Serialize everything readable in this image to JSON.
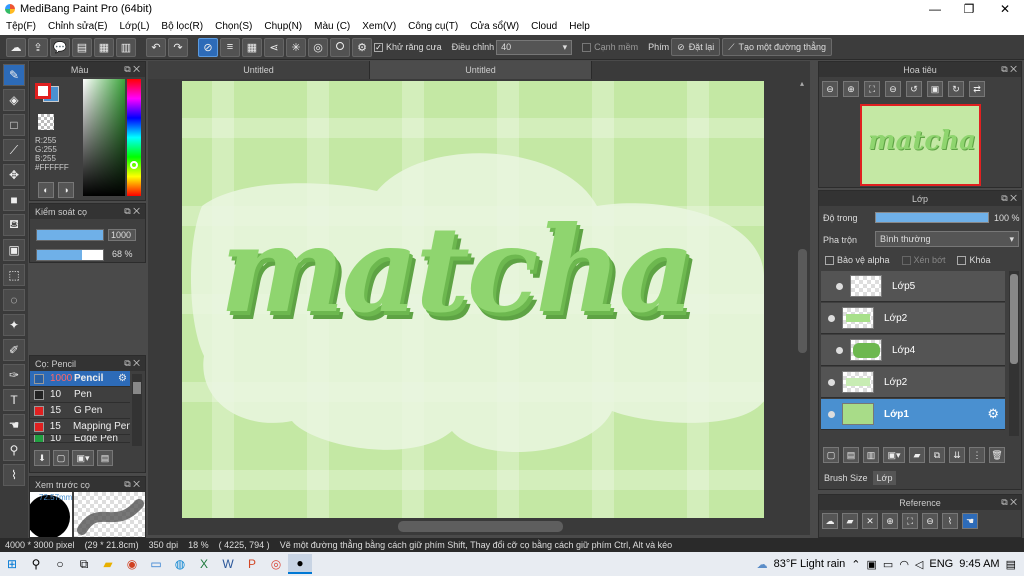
{
  "window": {
    "title": "MediBang Paint Pro (64bit)",
    "min": "—",
    "max": "❐",
    "close": "✕"
  },
  "menu": [
    "Tệp(F)",
    "Chỉnh sửa(E)",
    "Lớp(L)",
    "Bộ lọc(R)",
    "Chọn(S)",
    "Chụp(N)",
    "Màu (C)",
    "Xem(V)",
    "Công cụ(T)",
    "Cửa sổ(W)",
    "Cloud",
    "Help"
  ],
  "toolbar": {
    "antialias_label": "Khử răng cưa",
    "adjust_label": "Điều chỉnh",
    "adjust_value": "40",
    "soft_edge_label": "Cạnh mềm",
    "key_label": "Phím",
    "reset_label": "Đặt lại",
    "straight_line_label": "Tạo một đường thẳng"
  },
  "tabs": [
    "Untitled",
    "Untitled"
  ],
  "color_panel": {
    "title": "Màu",
    "r": "R:255",
    "g": "G:255",
    "b": "B:255",
    "hex": "#FFFFFF",
    "primary": "#e02020",
    "secondary": "#4a90d0"
  },
  "brush_control": {
    "title": "Kiểm soát cọ",
    "size": "1000",
    "opacity": "68 %",
    "opacity_fraction": 0.68,
    "size_fraction": 1.0
  },
  "brush_panel": {
    "title": "Cọ: Pencil",
    "items": [
      {
        "size": "1000",
        "name": "Pencil",
        "color": "#2a5fa0"
      },
      {
        "size": "10",
        "name": "Pen",
        "color": "#222222"
      },
      {
        "size": "15",
        "name": "G Pen",
        "color": "#e02020"
      },
      {
        "size": "15",
        "name": "Mapping Pen",
        "color": "#e02020"
      },
      {
        "size": "10",
        "name": "Edge Pen",
        "color": "#20a040"
      }
    ]
  },
  "preview_panel": {
    "title": "Xem trước cọ",
    "size_label": "72.57mm"
  },
  "canvas": {
    "text": "matcha"
  },
  "navigator": {
    "title": "Hoa tiêu",
    "thumb_text": "matcha"
  },
  "layer_panel": {
    "title": "Lớp",
    "opacity_label": "Độ trong",
    "opacity_value": "100 %",
    "blend_label": "Pha trộn",
    "blend_value": "Bình thường",
    "protect_alpha": "Bảo vệ alpha",
    "clipping": "Xén bớt",
    "lock": "Khóa",
    "layers": [
      "Lớp5",
      "Lớp2",
      "Lớp4",
      "Lớp2",
      "Lớp1"
    ],
    "tab_brush_size": "Brush Size",
    "tab_layer": "Lớp"
  },
  "reference_panel": {
    "title": "Reference"
  },
  "status": {
    "size": "4000 * 3000 pixel",
    "cm": "(29 * 21.8cm)",
    "dpi": "350 dpi",
    "zoom": "18 %",
    "coords": "( 4225, 794 )",
    "hint": "Vẽ một đường thẳng bằng cách giữ phím Shift, Thay đổi cỡ cọ bằng cách giữ phím Ctrl, Alt và kéo"
  },
  "taskbar": {
    "weather": "83°F  Light rain",
    "lang": "ENG",
    "time": "9:45 AM"
  }
}
